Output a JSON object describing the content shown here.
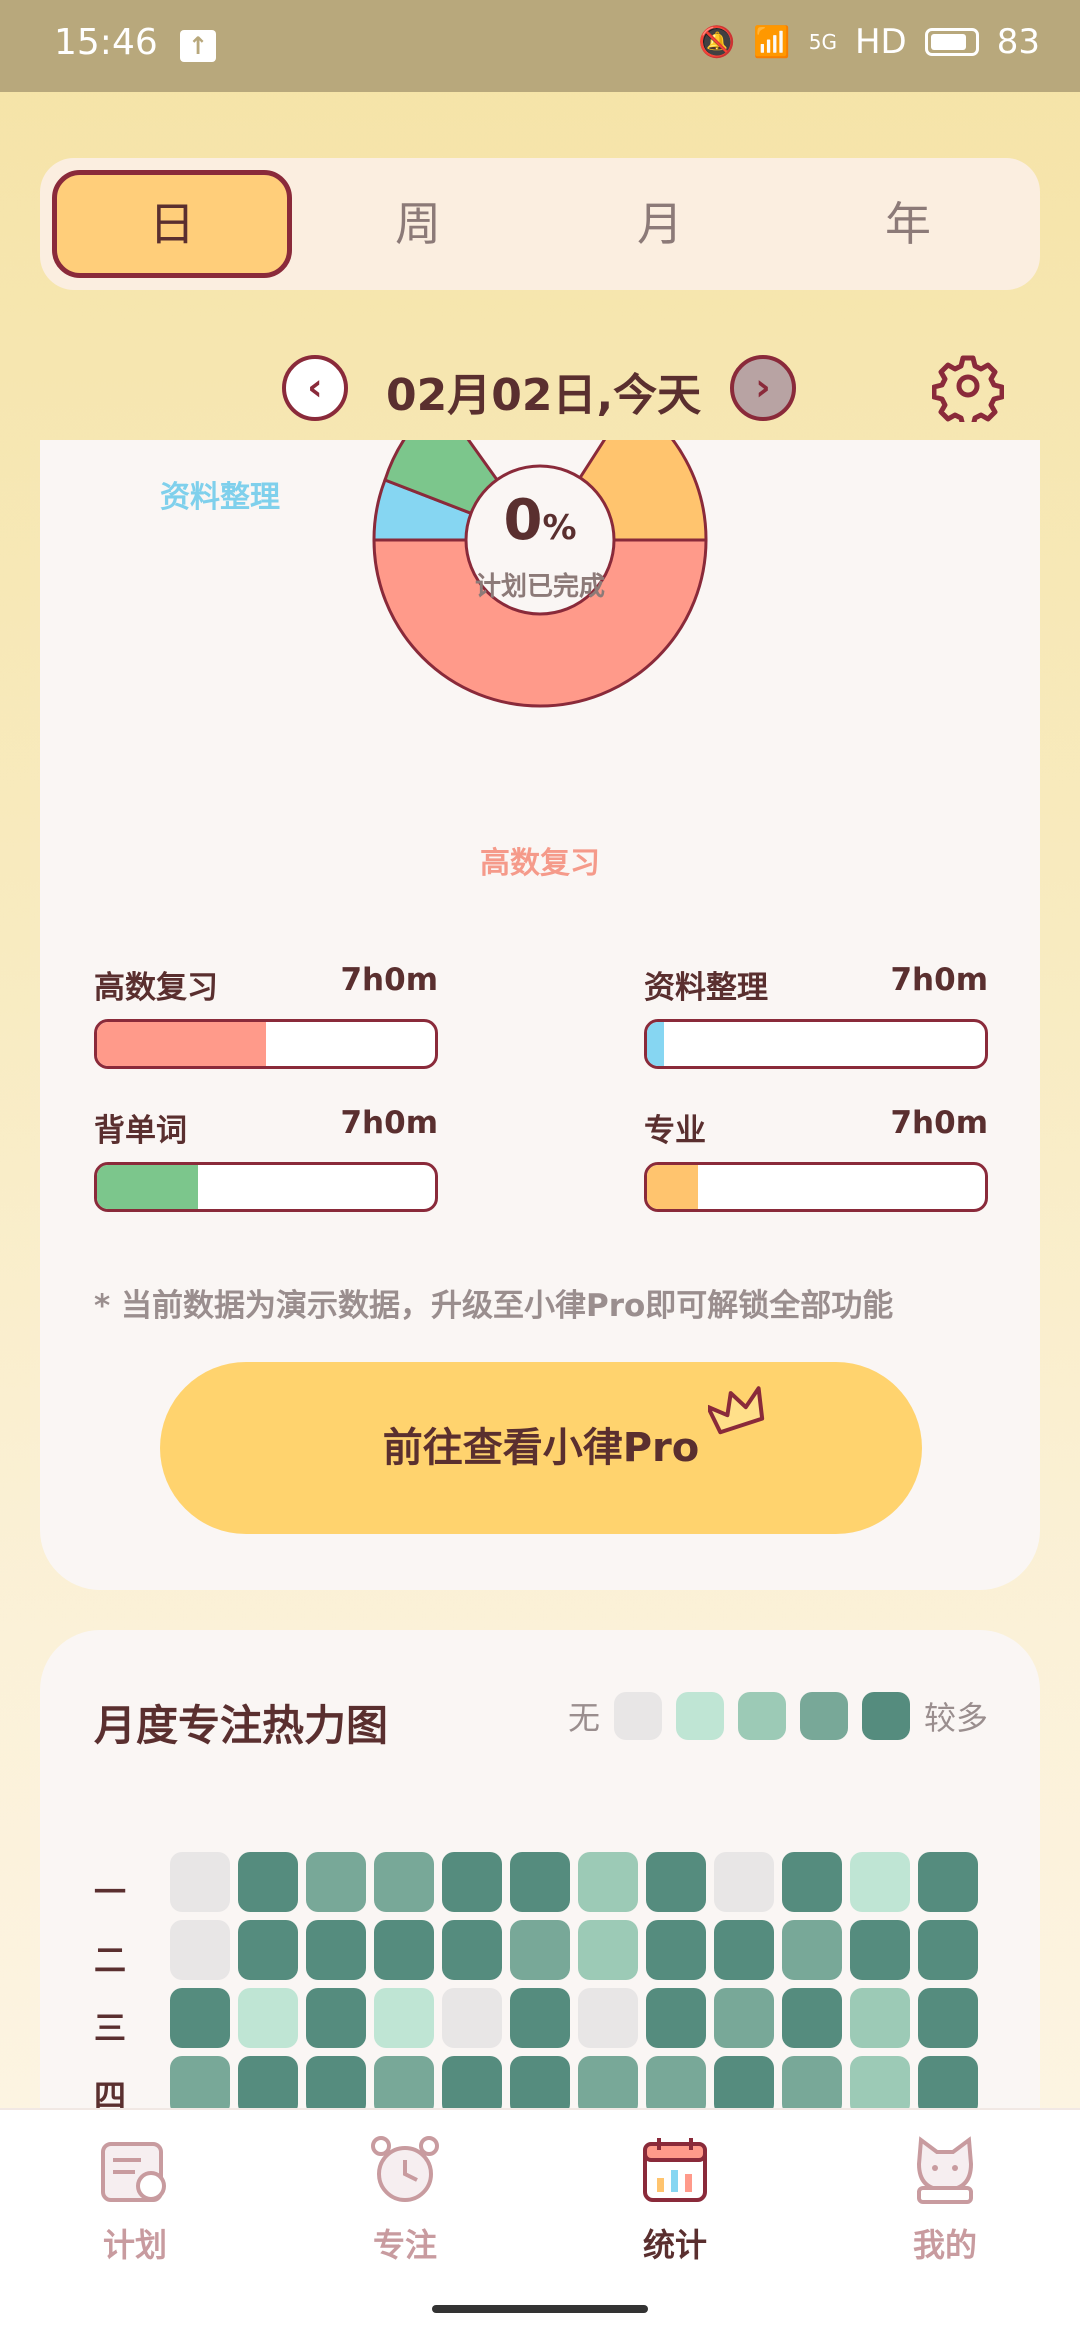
{
  "status_bar": {
    "time": "15:46",
    "network": "HD",
    "signal": "5G",
    "battery": "83"
  },
  "tabs": [
    {
      "label": "日",
      "active": true
    },
    {
      "label": "周",
      "active": false
    },
    {
      "label": "月",
      "active": false
    },
    {
      "label": "年",
      "active": false
    }
  ],
  "date_nav": {
    "prev": "‹",
    "label": "02月02日,今天",
    "next": "›"
  },
  "donut": {
    "percent": "0",
    "percent_unit": "%",
    "subtitle": "计划已完成",
    "label_ziliao": "资料整理",
    "label_gaoshu": "高数复习"
  },
  "bars": [
    {
      "name": "高数复习",
      "time": "7h0m",
      "fill": 0.5,
      "color": "#ff9a8a"
    },
    {
      "name": "资料整理",
      "time": "7h0m",
      "fill": 0.05,
      "color": "#86d6f2"
    },
    {
      "name": "背单词",
      "time": "7h0m",
      "fill": 0.3,
      "color": "#7cc68c"
    },
    {
      "name": "专业",
      "time": "7h0m",
      "fill": 0.15,
      "color": "#ffc46e"
    }
  ],
  "notice": "* 当前数据为演示数据，升级至小律Pro即可解锁全部功能",
  "pro_button": "前往查看小律Pro",
  "heatmap": {
    "title": "月度专注热力图",
    "legend_low": "无",
    "legend_high": "较多",
    "legend_colors": [
      "#e8e6e6",
      "#bfe5d4",
      "#9ccab6",
      "#78a898",
      "#558c7e"
    ],
    "row_labels": [
      "一",
      "二",
      "三",
      "四"
    ],
    "rows": [
      [
        0,
        4,
        3,
        3,
        4,
        4,
        2,
        4,
        0,
        4,
        1,
        4
      ],
      [
        0,
        4,
        4,
        4,
        4,
        3,
        2,
        4,
        4,
        3,
        4,
        4
      ],
      [
        4,
        1,
        4,
        1,
        0,
        4,
        0,
        4,
        3,
        4,
        2,
        4
      ],
      [
        3,
        4,
        4,
        3,
        4,
        4,
        3,
        3,
        4,
        3,
        2,
        4
      ]
    ]
  },
  "bottom_nav": [
    {
      "label": "计划",
      "icon": "plan-icon",
      "active": false
    },
    {
      "label": "专注",
      "icon": "alarm-clock-icon",
      "active": false
    },
    {
      "label": "统计",
      "icon": "chart-calendar-icon",
      "active": true
    },
    {
      "label": "我的",
      "icon": "cat-profile-icon",
      "active": false
    }
  ]
}
